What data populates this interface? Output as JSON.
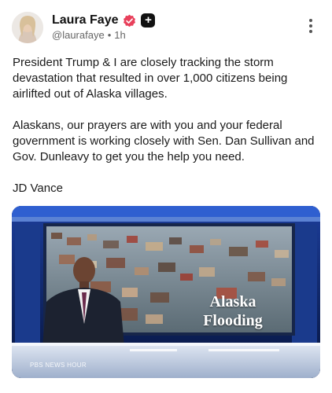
{
  "author": {
    "name": "Laura Faye",
    "handle": "@laurafaye",
    "time": "1h"
  },
  "post": {
    "paragraphs": [
      "President Trump & I are closely tracking the storm devastation that resulted in over 1,000 citizens being airlifted out of Alaska villages.",
      "Alaskans, our prayers are with you and your federal government is working closely with Sen. Dan Sullivan and Gov. Dunleavy to get you the help you need.",
      "JD Vance"
    ]
  },
  "media": {
    "caption_line1": "Alaska",
    "caption_line2": "Flooding",
    "watermark": "PBS NEWS HOUR"
  },
  "icons": {
    "verified": "verified-badge-icon",
    "plus": "plus-badge-icon",
    "more": "more-options-icon"
  },
  "colors": {
    "verified": "#e8405b",
    "studio": "#0b1f55"
  }
}
